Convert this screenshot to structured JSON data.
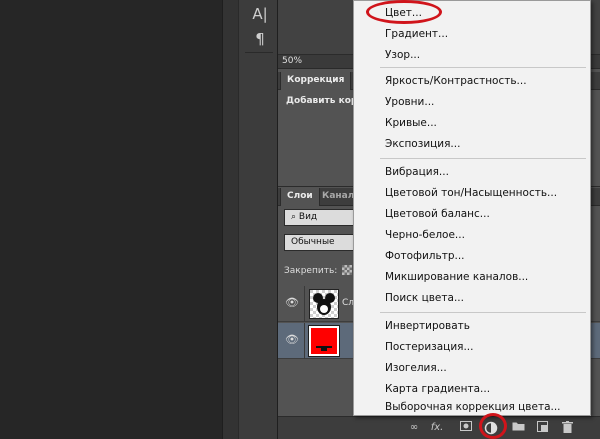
{
  "workspace": {
    "tools": [
      {
        "icon": "text-character-icon",
        "glyph": "A|"
      },
      {
        "icon": "paragraph-icon",
        "glyph": "¶"
      }
    ]
  },
  "panels": {
    "zoom": "50%",
    "adjustments": {
      "tab_label": "Коррекция",
      "title": "Добавить корр"
    },
    "layers": {
      "tabs": [
        "Слои",
        "Канал"
      ],
      "search_label": "Вид",
      "blend_mode": "Обычные",
      "lock_label": "Закрепить:",
      "rows": [
        {
          "name": "Сл",
          "thumbnail": "transparent-with-image",
          "selected": false
        },
        {
          "name": "",
          "thumbnail": "red-fill",
          "selected": true
        }
      ],
      "bottom_icons": [
        "link-icon",
        "fx-icon",
        "mask-icon",
        "adjustment-layer-icon",
        "group-folder-icon",
        "new-layer-icon",
        "trash-icon"
      ],
      "fx_label": "fx."
    }
  },
  "adjustment_menu": {
    "groups": [
      [
        "Цвет...",
        "Градиент...",
        "Узор..."
      ],
      [
        "Яркость/Контрастность...",
        "Уровни...",
        "Кривые...",
        "Экспозиция..."
      ],
      [
        "Вибрация...",
        "Цветовой тон/Насыщенность...",
        "Цветовой баланс...",
        "Черно-белое...",
        "Фотофильтр...",
        "Микширование каналов...",
        "Поиск цвета..."
      ],
      [
        "Инвертировать",
        "Постеризация...",
        "Изогелия...",
        "Карта градиента...",
        "Выборочная коррекция цвета..."
      ]
    ]
  },
  "annotations": {
    "highlight_color": "#d0141b",
    "highlighted": [
      "Цвет...",
      "adjustment-layer-icon"
    ]
  }
}
